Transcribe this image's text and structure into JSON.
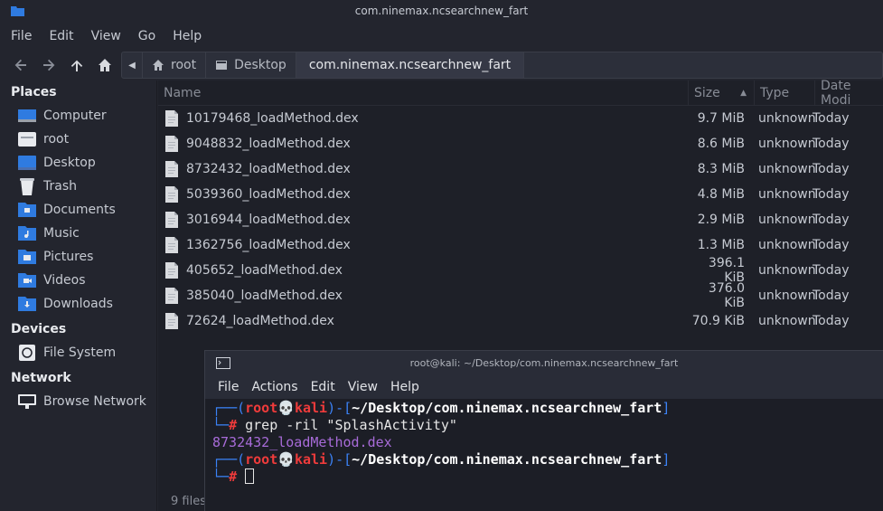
{
  "file_manager": {
    "title": "com.ninemax.ncsearchnew_fart",
    "menu": [
      "File",
      "Edit",
      "View",
      "Go",
      "Help"
    ],
    "breadcrumbs": {
      "root": "root",
      "desktop": "Desktop",
      "current": "com.ninemax.ncsearchnew_fart"
    },
    "sidebar": {
      "places_title": "Places",
      "places": [
        "Computer",
        "root",
        "Desktop",
        "Trash",
        "Documents",
        "Music",
        "Pictures",
        "Videos",
        "Downloads"
      ],
      "devices_title": "Devices",
      "devices": [
        "File System"
      ],
      "network_title": "Network",
      "network": [
        "Browse Network"
      ]
    },
    "columns": {
      "name": "Name",
      "size": "Size",
      "type": "Type",
      "date": "Date Modi"
    },
    "files": [
      {
        "name": "10179468_loadMethod.dex",
        "size": "9.7 MiB",
        "type": "unknown",
        "date": "Today"
      },
      {
        "name": "9048832_loadMethod.dex",
        "size": "8.6 MiB",
        "type": "unknown",
        "date": "Today"
      },
      {
        "name": "8732432_loadMethod.dex",
        "size": "8.3 MiB",
        "type": "unknown",
        "date": "Today"
      },
      {
        "name": "5039360_loadMethod.dex",
        "size": "4.8 MiB",
        "type": "unknown",
        "date": "Today"
      },
      {
        "name": "3016944_loadMethod.dex",
        "size": "2.9 MiB",
        "type": "unknown",
        "date": "Today"
      },
      {
        "name": "1362756_loadMethod.dex",
        "size": "1.3 MiB",
        "type": "unknown",
        "date": "Today"
      },
      {
        "name": "405652_loadMethod.dex",
        "size": "396.1 KiB",
        "type": "unknown",
        "date": "Today"
      },
      {
        "name": "385040_loadMethod.dex",
        "size": "376.0 KiB",
        "type": "unknown",
        "date": "Today"
      },
      {
        "name": "72624_loadMethod.dex",
        "size": "70.9 KiB",
        "type": "unknown",
        "date": "Today"
      }
    ],
    "status": "9 files"
  },
  "terminal": {
    "title": "root@kali: ~/Desktop/com.ninemax.ncsearchnew_fart",
    "menu": [
      "File",
      "Actions",
      "Edit",
      "View",
      "Help"
    ],
    "user": "root",
    "host": "kali",
    "cwd": "~/Desktop/com.ninemax.ncsearchnew_fart",
    "command": "grep -ril \"SplashActivity\"",
    "output": "8732432_loadMethod.dex",
    "prompt_char": "#"
  },
  "colors": {
    "prompt_blue": "#3b82f6",
    "prompt_red": "#ef3b3b",
    "output_purple": "#a76bd8",
    "folder_blue": "#2f7be0"
  }
}
